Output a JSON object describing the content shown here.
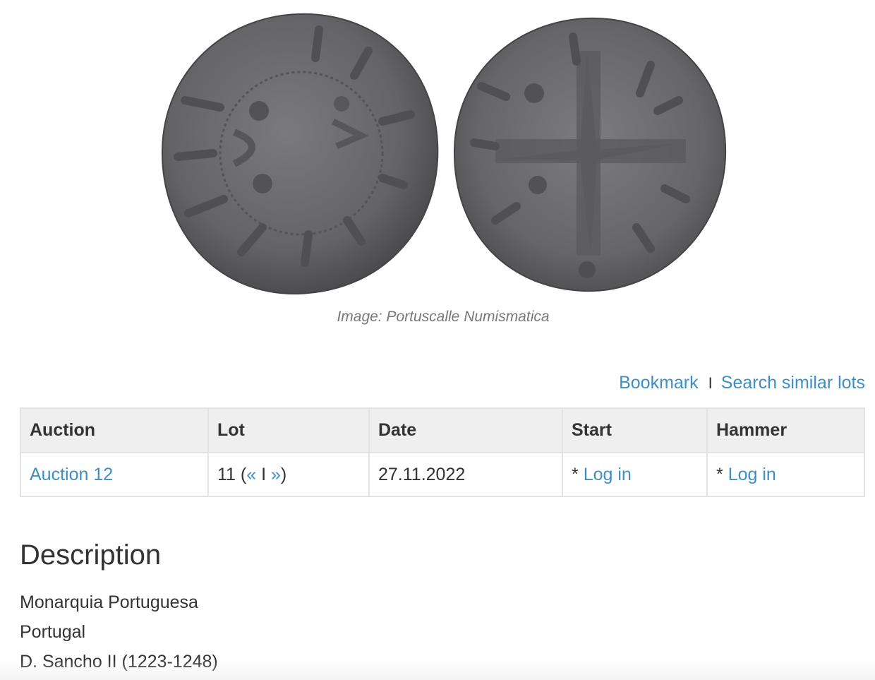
{
  "image": {
    "caption": "Image: Portuscalle Numismatica"
  },
  "actions": {
    "bookmark": "Bookmark",
    "separator": "I",
    "search_similar": "Search similar lots"
  },
  "lot_table": {
    "headers": [
      "Auction",
      "Lot",
      "Date",
      "Start",
      "Hammer"
    ],
    "row": {
      "auction": "Auction 12",
      "lot_number": "11",
      "lot_prev": "«",
      "lot_sep": "I",
      "lot_next": "»",
      "date": "27.11.2022",
      "start_prefix": "*",
      "start_link": "Log in",
      "hammer_prefix": "*",
      "hammer_link": "Log in"
    }
  },
  "description": {
    "title": "Description",
    "lines": [
      "Monarquia Portuguesa",
      "Portugal",
      "D. Sancho II (1223-1248)"
    ]
  },
  "colors": {
    "link": "#3d8fc6",
    "header_bg": "#efefef",
    "coin_metal": "#6e6e70"
  }
}
